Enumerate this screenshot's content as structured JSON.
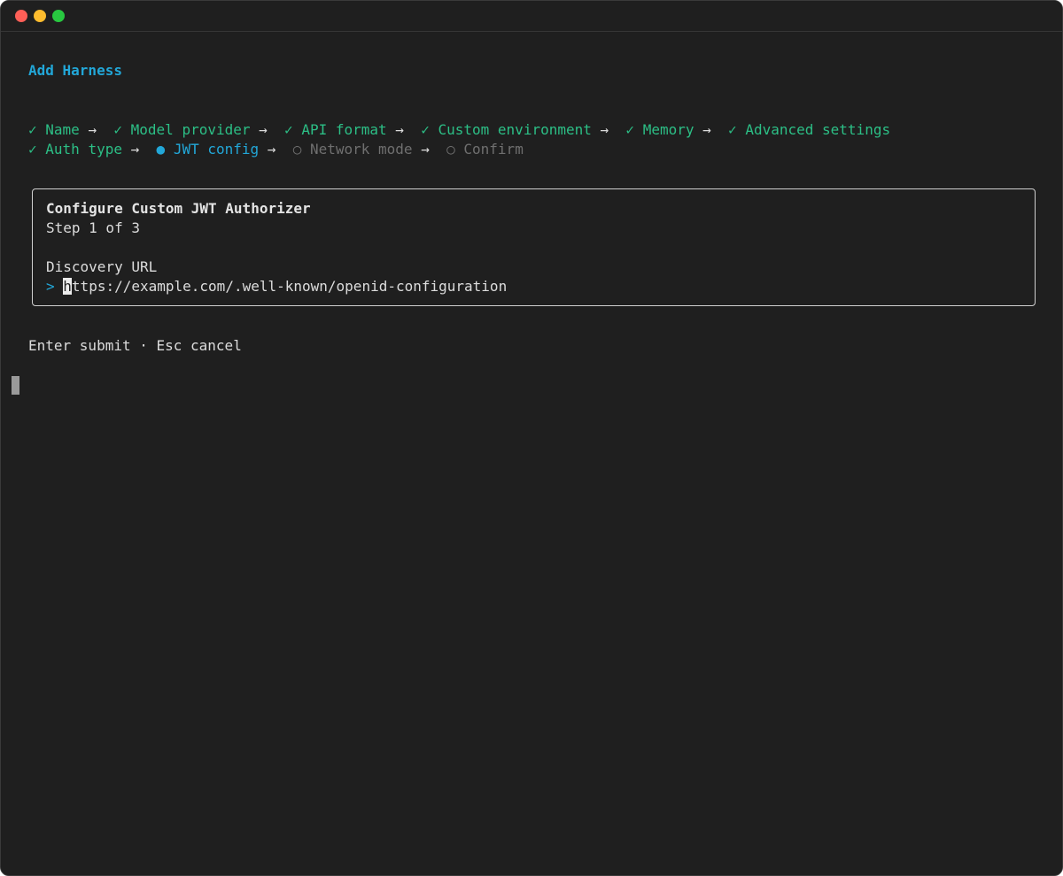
{
  "window": {
    "traffic_lights": [
      "close",
      "minimize",
      "maximize"
    ]
  },
  "heading": "Add Harness",
  "steps": {
    "check": "✓",
    "active_marker": "●",
    "pending_marker": "○",
    "arrow": "→",
    "items": [
      {
        "label": "Name",
        "state": "done"
      },
      {
        "label": "Model provider",
        "state": "done"
      },
      {
        "label": "API format",
        "state": "done"
      },
      {
        "label": "Custom environment",
        "state": "done"
      },
      {
        "label": "Memory",
        "state": "done"
      },
      {
        "label": "Advanced settings",
        "state": "done"
      },
      {
        "label": "Auth type",
        "state": "done"
      },
      {
        "label": "JWT config",
        "state": "active"
      },
      {
        "label": "Network mode",
        "state": "pending"
      },
      {
        "label": "Confirm",
        "state": "pending"
      }
    ]
  },
  "panel": {
    "title": "Configure Custom JWT Authorizer",
    "step": "Step 1 of 3",
    "field_label": "Discovery URL",
    "prompt": ">",
    "input_first_char": "h",
    "input_rest": "ttps://example.com/.well-known/openid-configuration"
  },
  "hint": "Enter submit · Esc cancel",
  "colors": {
    "background": "#1f1f1f",
    "accent": "#22a7d8",
    "done": "#2cbf86",
    "pending": "#6f6f6f",
    "text": "#dcdcdc"
  }
}
